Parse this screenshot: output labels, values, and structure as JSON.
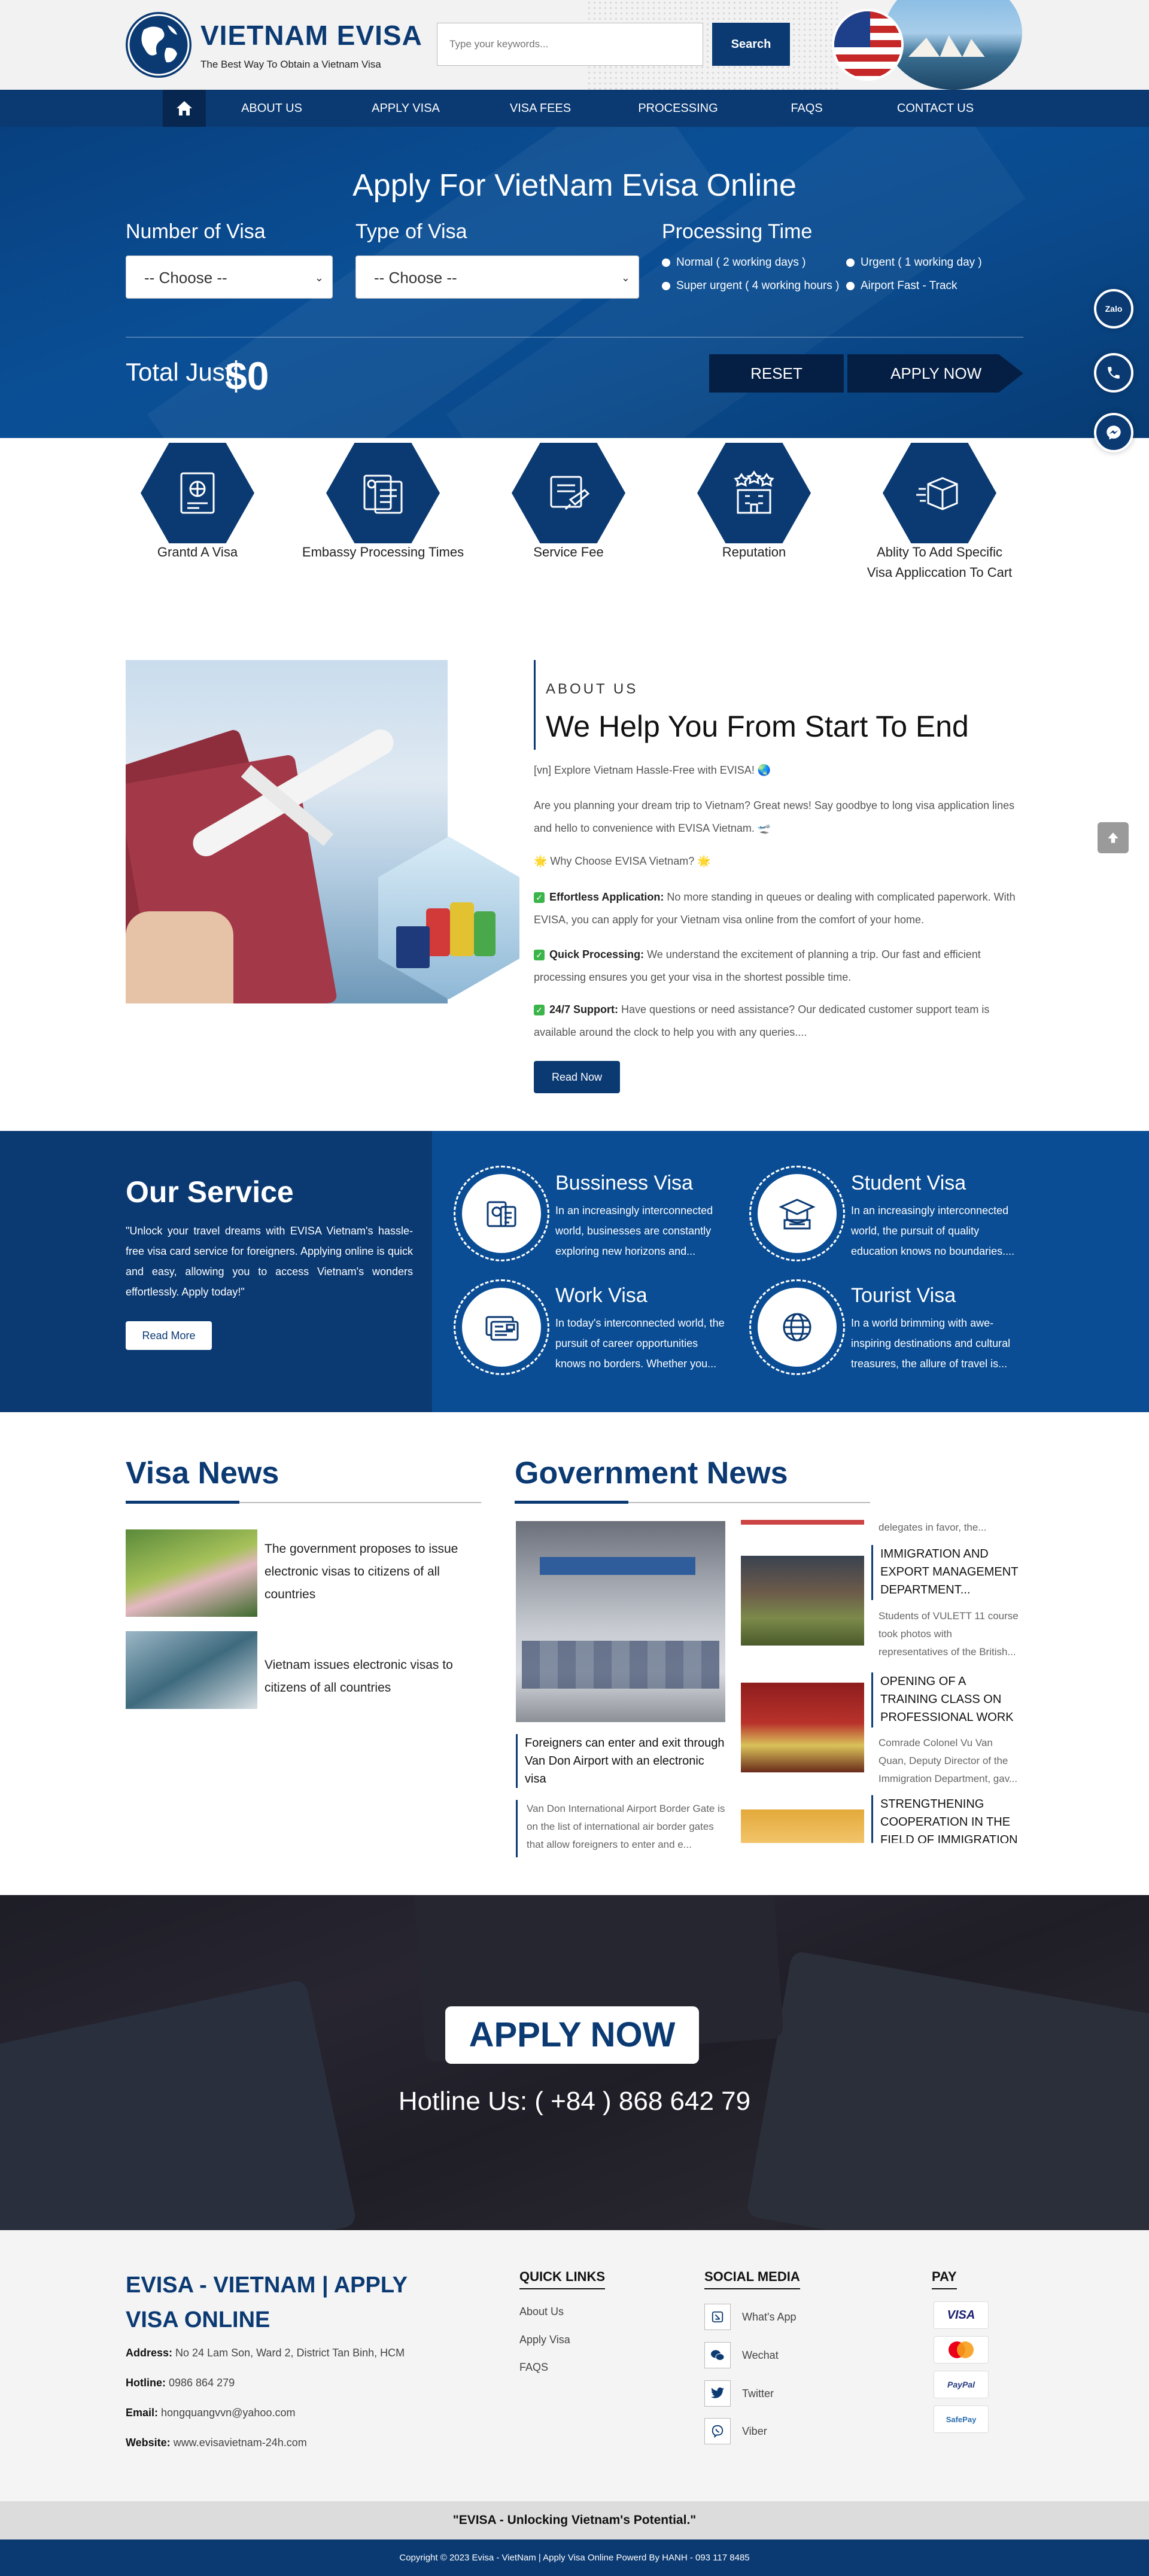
{
  "header": {
    "brand_name": "VIETNAM EVISA",
    "tagline": "The Best Way To Obtain a Vietnam Visa",
    "search_placeholder": "Type your keywords...",
    "search_button": "Search"
  },
  "nav": {
    "home_icon": "home-icon",
    "items": [
      {
        "label": "ABOUT US"
      },
      {
        "label": "APPLY VISA"
      },
      {
        "label": "VISA FEES"
      },
      {
        "label": "PROCESSING"
      },
      {
        "label": "FAQS"
      },
      {
        "label": "CONTACT US"
      }
    ]
  },
  "hero": {
    "title": "Apply For VietNam Evisa Online",
    "number_label": "Number of Visa",
    "type_label": "Type of Visa",
    "processing_label": "Processing Time",
    "number_value": "-- Choose --",
    "type_value": "-- Choose --",
    "options": [
      {
        "label": "Normal ( 2 working days )"
      },
      {
        "label": "Urgent ( 1 working day )"
      },
      {
        "label": "Super urgent ( 4 working hours )"
      },
      {
        "label": "Airport Fast - Track"
      }
    ],
    "total_label": "Total Just:",
    "total_value": "$0",
    "reset_label": "RESET",
    "apply_label": "APPLY NOW"
  },
  "floating": {
    "zalo_label": "Zalo",
    "icons": [
      "zalo-icon",
      "phone-icon",
      "messenger-icon",
      "arrow-up-icon"
    ]
  },
  "features": [
    {
      "label": "Grantd A Visa",
      "icon": "passport-icon"
    },
    {
      "label": "Embassy Processing Times",
      "icon": "documents-icon"
    },
    {
      "label": "Service Fee",
      "icon": "ticket-icon"
    },
    {
      "label": "Reputation",
      "icon": "building-icon"
    },
    {
      "label": "Ablity To Add Specific",
      "label2": "Visa Appliccation To Cart",
      "icon": "box-icon"
    }
  ],
  "about": {
    "kicker": "ABOUT US",
    "title": "We Help You From Start To End",
    "intro": "[vn] Explore Vietnam Hassle-Free with EVISA! 🌏",
    "p1": "Are you planning your dream trip to Vietnam? Great news! Say goodbye to long visa application lines and hello to convenience with EVISA Vietnam. 🛫",
    "why": "🌟 Why Choose EVISA Vietnam? 🌟",
    "b1_title": "Effortless Application:",
    "b1_text": " No more standing in queues or dealing with complicated paperwork. With EVISA, you can apply for your Vietnam visa online from the comfort of your home.",
    "b2_title": "Quick Processing:",
    "b2_text": " We understand the excitement of planning a trip. Our fast and efficient processing ensures you get your visa in the shortest possible time.",
    "b3_title": "24/7 Support:",
    "b3_text": " Have questions or need assistance? Our dedicated customer support team is available around the clock to help you with any queries....",
    "read_now": "Read Now"
  },
  "services": {
    "title": "Our Service",
    "text": "\"Unlock your travel dreams with EVISA Vietnam's hassle-free visa card service for foreigners. Applying online is quick and easy, allowing you to access Vietnam's wonders effortlessly. Apply today!\"",
    "read_more": "Read More",
    "items": [
      {
        "name": "Bussiness Visa",
        "icon": "business-visa-icon",
        "desc": "In an increasingly interconnected world, businesses are constantly exploring new horizons and..."
      },
      {
        "name": "Student Visa",
        "icon": "graduation-cap-icon",
        "desc": "In an increasingly interconnected world, the pursuit of quality education knows no boundaries...."
      },
      {
        "name": "Work Visa",
        "icon": "id-card-icon",
        "desc": "In today's interconnected world, the pursuit of career opportunities knows no borders. Whether you..."
      },
      {
        "name": "Tourist Visa",
        "icon": "globe-icon",
        "desc": "In a world brimming with awe-inspiring destinations and cultural treasures, the allure of travel is..."
      }
    ]
  },
  "visa_news": {
    "heading": "Visa News",
    "items": [
      {
        "title": "The government proposes to issue electronic visas to citizens of all countries"
      },
      {
        "title": "Vietnam issues electronic visas to citizens of all countries"
      }
    ]
  },
  "gov_news": {
    "heading": "Government News",
    "feature_title": "Foreigners can enter and exit through Van Don Airport with an electronic visa",
    "feature_desc": "Van Don International Airport Border Gate is on the list of international air border gates that allow foreigners to enter and e...",
    "top_fragment": "delegates in favor, the...",
    "side": [
      {
        "title": "IMMIGRATION AND EXPORT MANAGEMENT DEPARTMENT...",
        "desc": "Students of VULETT 11 course took photos with representatives of the British..."
      },
      {
        "title": "OPENING OF A TRAINING CLASS ON PROFESSIONAL WORK I...",
        "desc": "Comrade Colonel Vu Van Quan, Deputy Director of the Immigration Department, gav..."
      },
      {
        "title": "STRENGTHENING COOPERATION IN THE FIELD OF IMMIGRATION",
        "desc": ""
      }
    ]
  },
  "cta": {
    "button": "APPLY NOW",
    "hotline": "Hotline Us: ( +84 ) 868 642 79"
  },
  "footer": {
    "brand": "EVISA - VIETNAM | APPLY VISA ONLINE",
    "address_label": "Address:",
    "address": " No 24 Lam Son, Ward 2, District Tan Binh, HCM",
    "hotline_label": "Hotline:",
    "hotline": " 0986 864 279",
    "email_label": "Email:",
    "email": " hongquangvvn@yahoo.com",
    "website_label": "Website:",
    "website": " www.evisavietnam-24h.com",
    "quick_links_title": "QUICK LINKS",
    "quick_links": [
      "About Us",
      "Apply Visa",
      "FAQS"
    ],
    "social_title": "SOCIAL MEDIA",
    "social": [
      {
        "label": "What's App",
        "icon": "whatsapp-icon"
      },
      {
        "label": "Wechat",
        "icon": "wechat-icon"
      },
      {
        "label": "Twitter",
        "icon": "twitter-icon"
      },
      {
        "label": "Viber",
        "icon": "viber-icon"
      }
    ],
    "pay_title": "PAY",
    "pay": [
      "VISA",
      "mastercard",
      "PayPal",
      "SafePay"
    ],
    "slogan": "\"EVISA - Unlocking Vietnam's Potential.\"",
    "copyright": "Copyright © 2023 Evisa - VietNam | Apply Visa Online Powerd By HANH - 093 117 8485"
  },
  "colors": {
    "primary": "#0b3a73",
    "secondary": "#0a4d94",
    "hero": "#0a4f96"
  }
}
